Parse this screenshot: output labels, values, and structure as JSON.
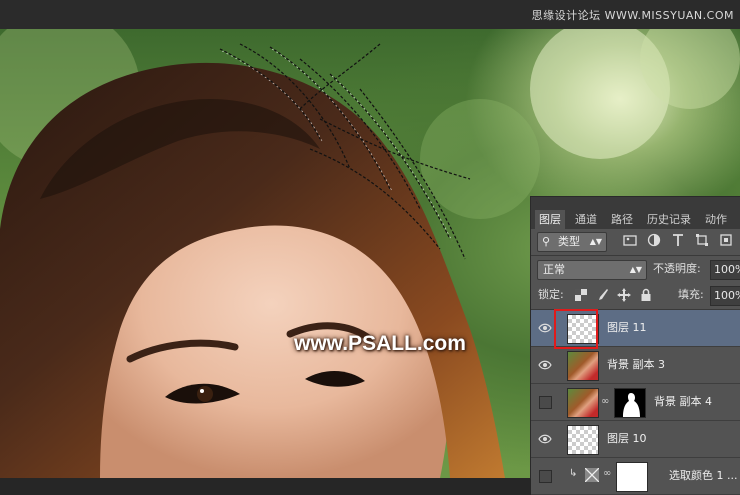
{
  "brand": "思缘设计论坛 WWW.MISSYUAN.COM",
  "watermark": "www.PSALL.com",
  "layers_panel": {
    "tabs": [
      {
        "label": "图层",
        "active": true
      },
      {
        "label": "通道",
        "active": false
      },
      {
        "label": "路径",
        "active": false
      },
      {
        "label": "历史记录",
        "active": false
      },
      {
        "label": "动作",
        "active": false
      }
    ],
    "filter_type": "类型",
    "blend_mode": "正常",
    "opacity_label": "不透明度:",
    "opacity_value": "100%",
    "lock_label": "锁定:",
    "fill_label": "填充:",
    "fill_value": "100%",
    "layers": [
      {
        "name": "图层 11",
        "visible": true,
        "selected": true,
        "thumb": "transparent"
      },
      {
        "name": "背景 副本 3",
        "visible": true,
        "selected": false,
        "thumb": "photo"
      },
      {
        "name": "背景 副本 4",
        "visible": false,
        "selected": false,
        "thumb": "photo",
        "mask": true
      },
      {
        "name": "图层 10",
        "visible": true,
        "selected": false,
        "thumb": "transparent"
      },
      {
        "name": "选取颜色 1 ...",
        "visible": false,
        "selected": false,
        "thumb": "adjustment"
      }
    ]
  },
  "colors": {
    "panel_bg": "#535353",
    "selected_layer": "#5d6d85",
    "highlight_box": "#e01b1b"
  }
}
